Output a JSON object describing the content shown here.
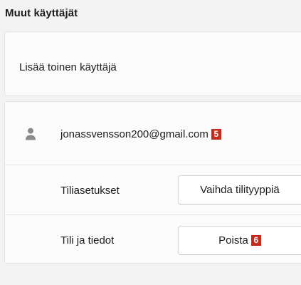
{
  "section": {
    "title": "Muut käyttäjät"
  },
  "add_user": {
    "label": "Lisää toinen käyttäjä"
  },
  "account": {
    "avatar_icon": "person-icon",
    "email": "jonassvensson200@gmail.com",
    "email_badge": "5",
    "settings": {
      "label": "Tiliasetukset",
      "button_label": "Vaihda tilityyppiä"
    },
    "info": {
      "label": "Tili ja tiedot",
      "button_label": "Poista",
      "button_badge": "6"
    }
  },
  "colors": {
    "background": "#f3f3f3",
    "card": "#fbfbfb",
    "badge": "#c42b1c",
    "text": "#1b1b1b"
  }
}
